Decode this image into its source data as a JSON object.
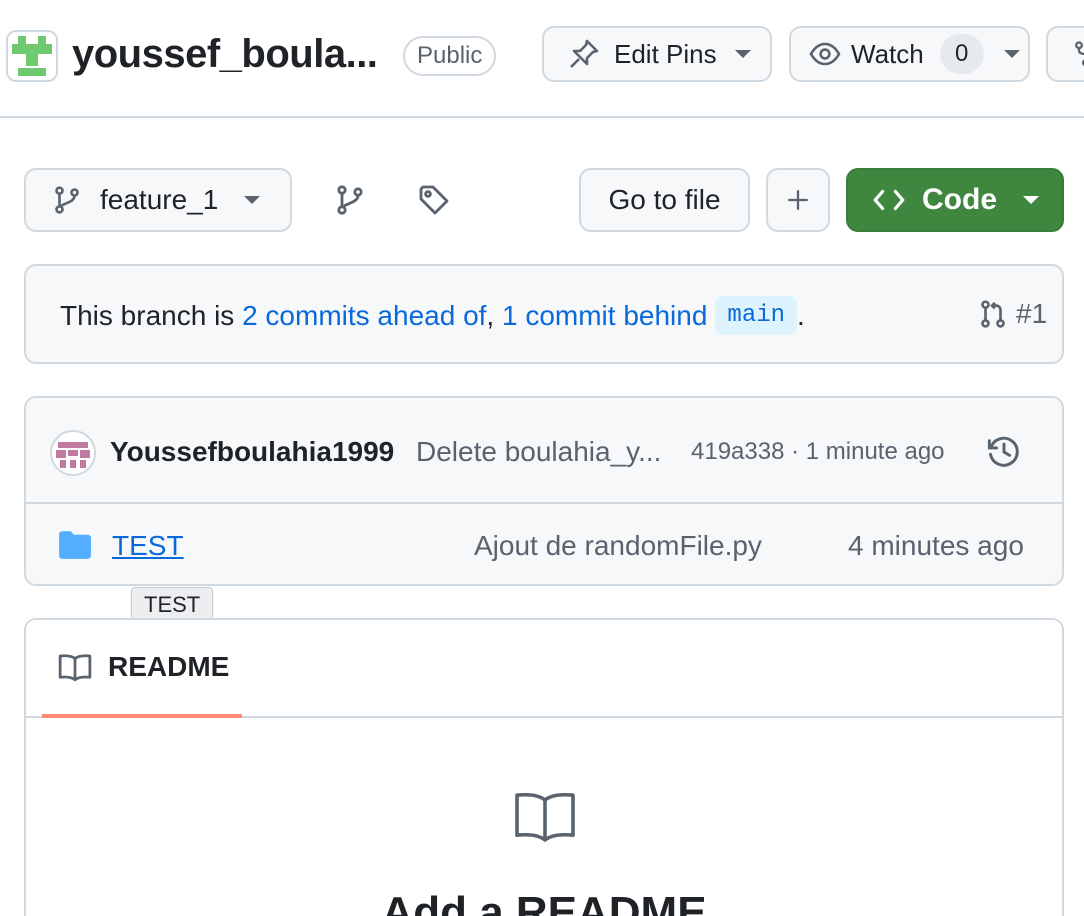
{
  "repo": {
    "name": "youssef_boula...",
    "visibility": "Public"
  },
  "header_actions": {
    "edit_pins": "Edit Pins",
    "watch": "Watch",
    "watch_count": "0"
  },
  "toolbar": {
    "branch": "feature_1",
    "go_to_file": "Go to file",
    "add": "+",
    "code": "Code"
  },
  "branch_status": {
    "prefix": "This branch is ",
    "ahead": "2 commits ahead of",
    "separator": ", ",
    "behind": "1 commit behind",
    "base": "main",
    "suffix": ".",
    "pr": "#1"
  },
  "latest_commit": {
    "author": "Youssefboulahia1999",
    "message": "Delete boulahia_y...",
    "hash_time": "419a338 · 1 minute ago"
  },
  "files": [
    {
      "name": "TEST",
      "message": "Ajout de randomFile.py",
      "time": "4 minutes ago"
    }
  ],
  "tooltip": "TEST",
  "readme": {
    "tab": "README",
    "heading": "Add a README"
  },
  "colors": {
    "accent": "#0969da",
    "code_button": "#3f873f",
    "tab_underline": "#fd8c73",
    "folder": "#54aeff"
  }
}
